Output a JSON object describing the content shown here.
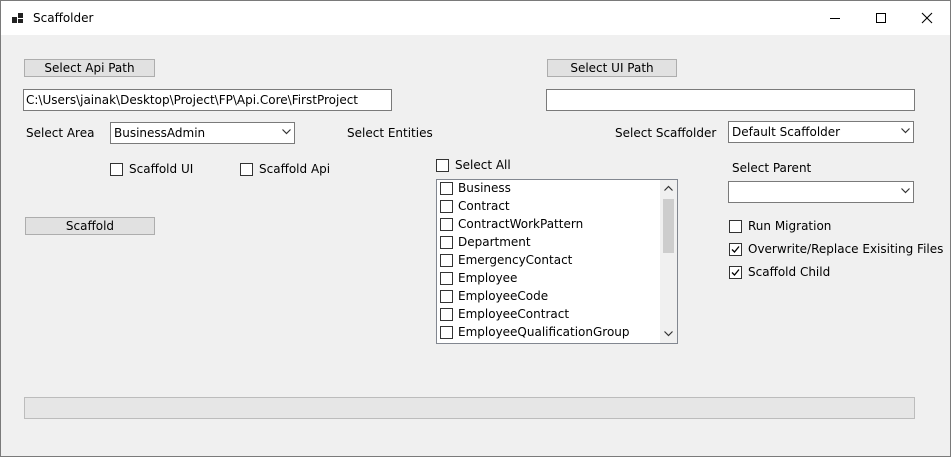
{
  "window": {
    "title": "Scaffolder"
  },
  "buttons": {
    "select_api_path": "Select Api Path",
    "select_ui_path": "Select UI Path",
    "scaffold": "Scaffold"
  },
  "inputs": {
    "api_path": "C:\\Users\\jainak\\Desktop\\Project\\FP\\Api.Core\\FirstProject",
    "ui_path": ""
  },
  "labels": {
    "select_area": "Select Area",
    "select_entities": "Select Entities",
    "select_scaffolder": "Select Scaffolder",
    "select_parent": "Select Parent"
  },
  "combos": {
    "area": "BusinessAdmin",
    "scaffolder": "Default Scaffolder",
    "parent": ""
  },
  "checkboxes": {
    "scaffold_ui": {
      "label": "Scaffold UI",
      "checked": false
    },
    "scaffold_api": {
      "label": "Scaffold Api",
      "checked": false
    },
    "select_all": {
      "label": "Select All",
      "checked": false
    },
    "run_migration": {
      "label": "Run Migration",
      "checked": false
    },
    "overwrite": {
      "label": "Overwrite/Replace Exisiting Files",
      "checked": true
    },
    "scaffold_child": {
      "label": "Scaffold Child",
      "checked": true
    }
  },
  "entities": [
    {
      "label": "Business",
      "checked": false
    },
    {
      "label": "Contract",
      "checked": false
    },
    {
      "label": "ContractWorkPattern",
      "checked": false
    },
    {
      "label": "Department",
      "checked": false
    },
    {
      "label": "EmergencyContact",
      "checked": false
    },
    {
      "label": "Employee",
      "checked": false
    },
    {
      "label": "EmployeeCode",
      "checked": false
    },
    {
      "label": "EmployeeContract",
      "checked": false
    },
    {
      "label": "EmployeeQualificationGroup",
      "checked": false
    }
  ],
  "progress": {
    "fraction": 0
  },
  "icons": {
    "app": "app-icon",
    "minimize": "minimize-icon",
    "maximize": "maximize-icon",
    "close": "close-icon",
    "dropdown": "chevron-down-icon",
    "check": "check-icon"
  }
}
